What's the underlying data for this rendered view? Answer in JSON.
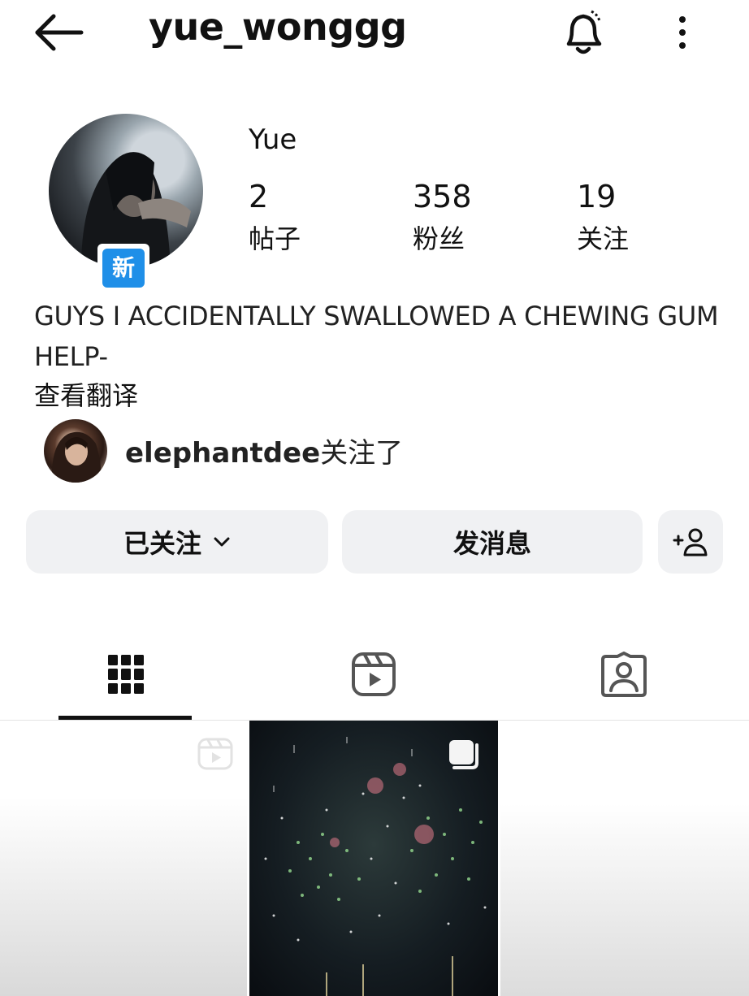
{
  "header": {
    "username": "yue_wonggg",
    "icons": [
      "back-arrow-icon",
      "bell-icon",
      "more-vertical-icon"
    ]
  },
  "profile": {
    "display_name": "Yue",
    "new_badge": "新",
    "stats": [
      {
        "value": "2",
        "label": "帖子"
      },
      {
        "value": "358",
        "label": "粉丝"
      },
      {
        "value": "19",
        "label": "关注"
      }
    ],
    "bio": "GUYS I ACCIDENTALLY SWALLOWED A CHEWING GUM HELP-",
    "translate_link": "查看翻译",
    "followed_by_user": "elephantdee",
    "followed_by_suffix": "关注了"
  },
  "actions": {
    "following_label": "已关注",
    "message_label": "发消息"
  },
  "tabs": {
    "icons": [
      "grid-icon",
      "reels-icon",
      "tagged-icon"
    ],
    "active": "grid"
  },
  "colors": {
    "badge_blue": "#1f8fe8",
    "button_bg": "#f0f1f3"
  }
}
